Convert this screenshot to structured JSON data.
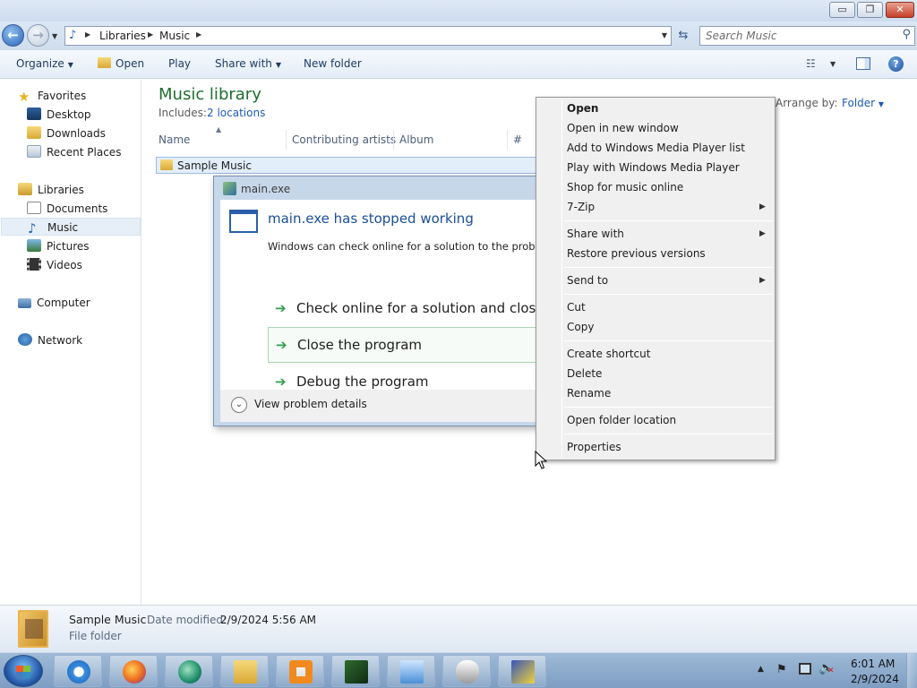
{
  "window": {
    "minimize_glyph": "▭",
    "maximize_glyph": "❐",
    "close_glyph": "✕"
  },
  "address": {
    "crumbs": [
      "Libraries",
      "Music"
    ],
    "search_placeholder": "Search Music"
  },
  "toolbar": {
    "organize": "Organize",
    "open": "Open",
    "play": "Play",
    "share_with": "Share with",
    "new_folder": "New folder"
  },
  "nav": {
    "favorites": "Favorites",
    "desktop": "Desktop",
    "downloads": "Downloads",
    "recent_places": "Recent Places",
    "libraries": "Libraries",
    "documents": "Documents",
    "music": "Music",
    "pictures": "Pictures",
    "videos": "Videos",
    "computer": "Computer",
    "network": "Network"
  },
  "library": {
    "title": "Music library",
    "includes_label": "Includes:",
    "locations": "2 locations",
    "arrange_label": "Arrange by:",
    "arrange_value": "Folder"
  },
  "columns": {
    "name": "Name",
    "artists": "Contributing artists",
    "album": "Album",
    "number": "#"
  },
  "files": [
    {
      "name": "Sample Music"
    }
  ],
  "dialog": {
    "title": "main.exe",
    "heading": "main.exe has stopped working",
    "message": "Windows can check online for a solution to the problem.",
    "option1": "Check online for a solution and close the program",
    "option2": "Close the program",
    "option3": "Debug the program",
    "details": "View problem details"
  },
  "context_menu": {
    "open": "Open",
    "open_new_window": "Open in new window",
    "add_wmp": "Add to Windows Media Player list",
    "play_wmp": "Play with Windows Media Player",
    "shop": "Shop for music online",
    "zip": "7-Zip",
    "share_with": "Share with",
    "restore": "Restore previous versions",
    "send_to": "Send to",
    "cut": "Cut",
    "copy": "Copy",
    "create_shortcut": "Create shortcut",
    "delete": "Delete",
    "rename": "Rename",
    "open_location": "Open folder location",
    "properties": "Properties"
  },
  "details_pane": {
    "name": "Sample Music",
    "modified_label": "Date modified:",
    "modified_value": "2/9/2024 5:56 AM",
    "type": "File folder"
  },
  "taskbar": {
    "apps": [
      "internet-explorer",
      "firefox",
      "app-green-circle",
      "file-explorer",
      "media-player",
      "system-monitor",
      "control-panel",
      "mouse-settings",
      "security-tool"
    ],
    "clock_time": "6:01 AM",
    "clock_date": "2/9/2024"
  },
  "colors": {
    "accent": "#1f5bb5",
    "library_title": "#1e6e2e",
    "option_arrow": "#2ea04a"
  }
}
